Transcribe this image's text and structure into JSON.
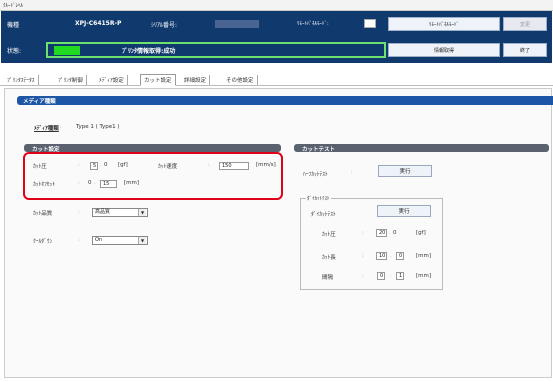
{
  "window": {
    "title": "ｸﾙｰﾄﾞﾚﾍﾙ"
  },
  "header": {
    "model_label": "機種",
    "model_value": "XPJ-C6415R-P",
    "serial_label": "ｼﾘｱﾙ番号:",
    "remote_label": "ﾘﾓｰﾄﾊﾟﾈﾙﾓｰﾄﾞ:",
    "status_label": "状態:",
    "status_text": "ﾌﾟﾘﾝﾀ情報取得:成功",
    "status_color": "#22d922",
    "buttons": {
      "remote_mode": "ﾘﾓｰﾄﾊﾟﾈﾙﾓｰﾄﾞ",
      "change": "変更",
      "get_info": "情報取得",
      "exit": "終了"
    }
  },
  "tabs": [
    {
      "label": "ﾌﾟﾘﾝﾀｽﾃｰﾀｽ"
    },
    {
      "label": "ﾌﾟﾘﾝﾀ制御"
    },
    {
      "label": "ﾒﾃﾞｨｱ設定"
    },
    {
      "label": "カット設定"
    },
    {
      "label": "詳細設定"
    },
    {
      "label": "その他設定"
    }
  ],
  "active_tab": "カット設定",
  "media": {
    "bar_title": "メディア種類",
    "type_label": "ﾒﾃﾞｨｱ種類",
    "type_value": "Type 1 ( Type1 )"
  },
  "cut_settings": {
    "title": "カット設定",
    "pressure_label": "ｶｯﾄ圧",
    "pressure_whole": "5",
    "pressure_frac": "0",
    "pressure_unit": "[gf]",
    "speed_label": "ｶｯﾄ速度",
    "speed_value": "150",
    "speed_unit": "[mm/s]",
    "offset_label": "ｶｯﾄｵﾌｾｯﾄ",
    "offset_whole": "0",
    "offset_frac": "15",
    "offset_unit": "[mm]",
    "quality_label": "ｶｯﾄ品質",
    "quality_value": "高品質",
    "cooldown_label": "ｸｰﾙﾀﾞｳﾝ",
    "cooldown_value": "On"
  },
  "cut_test": {
    "title": "カットテスト",
    "half_label": "ﾊｰﾌｶｯﾄﾃｽﾄ",
    "half_button": "実行",
    "die_group": "ﾀﾞｲｶｯﾄﾃｽﾄ",
    "die_label": "ﾀﾞｲｶｯﾄﾃｽﾄ",
    "die_button": "実行",
    "pressure_label": "ｶｯﾄ圧",
    "pressure_whole": "20",
    "pressure_frac": "0",
    "pressure_unit": "[gf]",
    "length_label": "ｶｯﾄ長",
    "length_whole": "10",
    "length_frac": "0",
    "length_unit": "[mm]",
    "interval_label": "間隔",
    "interval_whole": "0",
    "interval_frac": "1",
    "interval_unit": "[mm]"
  },
  "separators": {
    "colon": ":",
    "dot": "."
  }
}
